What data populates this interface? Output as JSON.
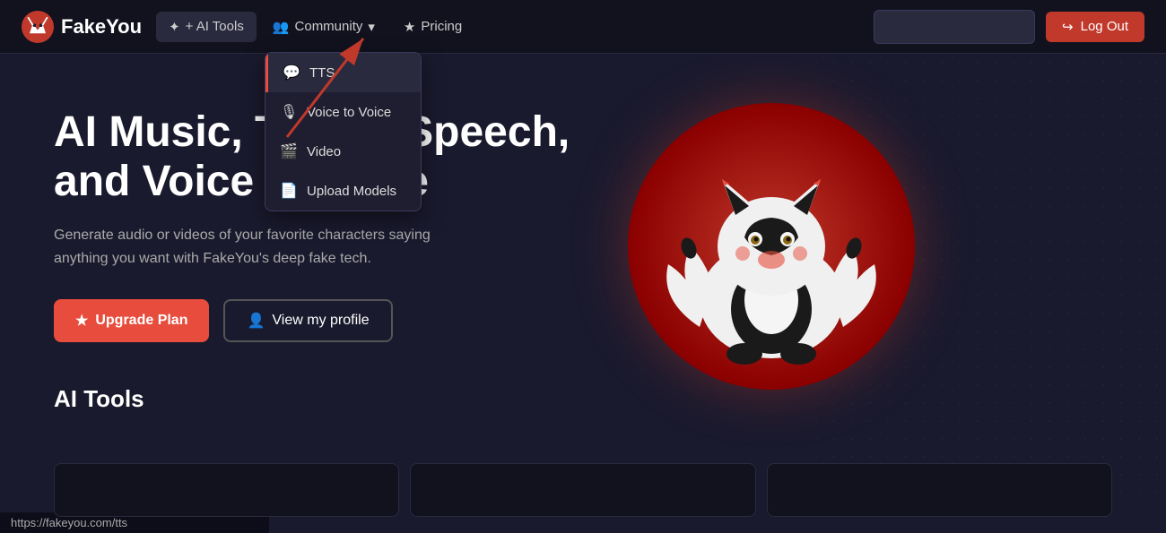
{
  "brand": {
    "name": "FakeYou",
    "logo_alt": "FakeYou wolf logo"
  },
  "nav": {
    "ai_tools_label": "+ AI Tools",
    "community_label": "Community",
    "pricing_label": "Pricing",
    "logout_label": "Log Out"
  },
  "dropdown": {
    "items": [
      {
        "id": "tts",
        "label": "TTS",
        "icon": "💬",
        "highlighted": true
      },
      {
        "id": "v2v",
        "label": "Voice to Voice",
        "icon": "🎙️",
        "highlighted": false
      },
      {
        "id": "video",
        "label": "Video",
        "icon": "🎬",
        "highlighted": false
      },
      {
        "id": "upload",
        "label": "Upload Models",
        "icon": "📁",
        "highlighted": false
      }
    ]
  },
  "hero": {
    "title": "AI Music, Text to Speech,\nand Voice to voice",
    "subtitle": "Generate audio or videos of your favorite characters saying anything you want with FakeYou's deep fake tech.",
    "upgrade_btn": "Upgrade Plan",
    "profile_btn": "View my profile",
    "tools_heading": "AI Tools"
  },
  "status_bar": {
    "url": "https://fakeyou.com/tts"
  },
  "tool_cards": [
    {
      "id": "card1"
    },
    {
      "id": "card2"
    },
    {
      "id": "card3"
    }
  ]
}
